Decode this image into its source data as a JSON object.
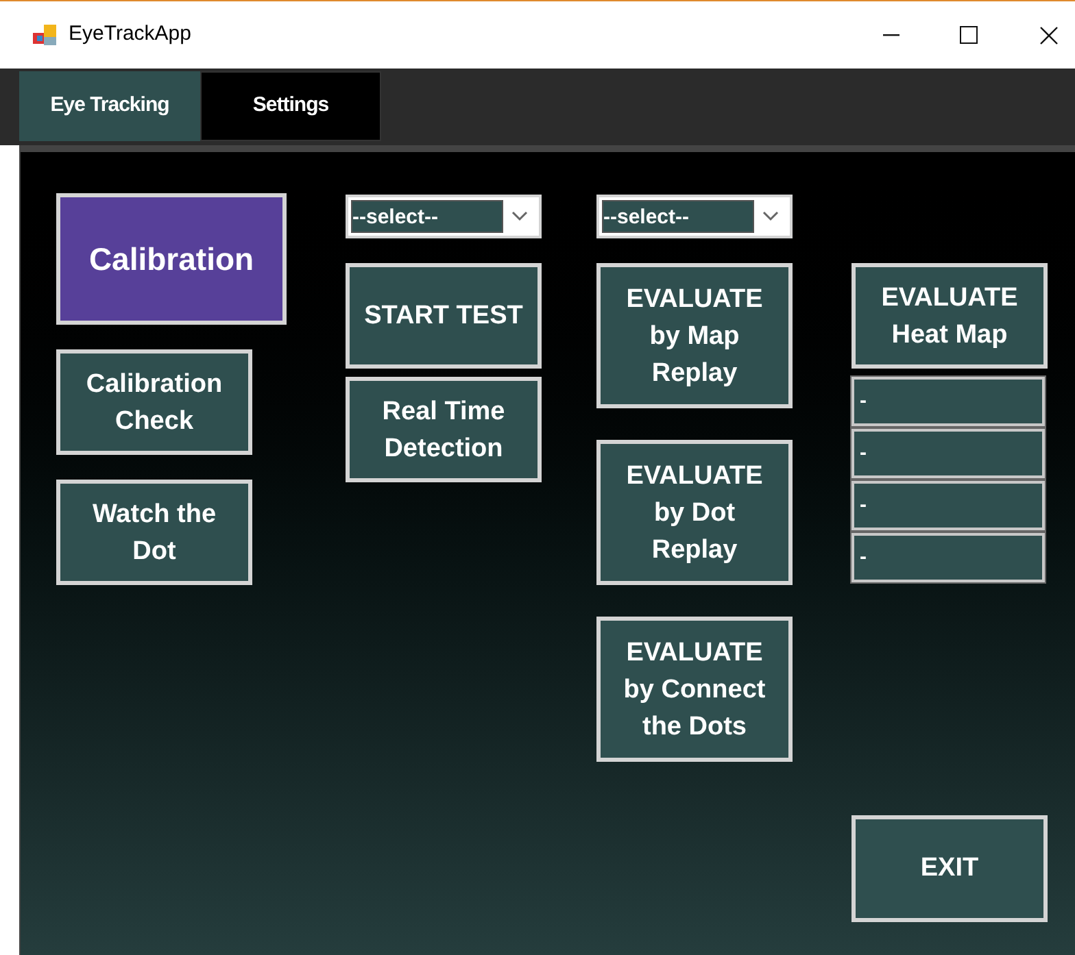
{
  "window": {
    "title": "EyeTrackApp"
  },
  "tabs": [
    {
      "label": "Eye Tracking",
      "selected": true
    },
    {
      "label": "Settings",
      "selected": false
    }
  ],
  "columns": [
    {
      "items": [
        {
          "kind": "primary",
          "label": "Calibration"
        },
        {
          "kind": "button",
          "label": "Calibration Check"
        },
        {
          "kind": "button",
          "label": "Watch the Dot"
        }
      ]
    },
    {
      "items": [
        {
          "kind": "select",
          "value": "--select--"
        },
        {
          "kind": "button",
          "label": "START TEST"
        },
        {
          "kind": "button",
          "label": "Real Time Detection"
        }
      ]
    },
    {
      "items": [
        {
          "kind": "select",
          "value": "--select--"
        },
        {
          "kind": "tall",
          "label": "EVALUATE by Map Replay"
        },
        {
          "kind": "tall",
          "label": "EVALUATE by Dot Replay"
        },
        {
          "kind": "tall",
          "label": "EVALUATE by Connect the Dots"
        }
      ]
    },
    {
      "items": [
        {
          "kind": "button",
          "label": "EVALUATE Heat Map"
        },
        {
          "kind": "result",
          "value": "-"
        },
        {
          "kind": "result",
          "value": "-"
        },
        {
          "kind": "result",
          "value": "-"
        },
        {
          "kind": "result",
          "value": "-"
        }
      ]
    }
  ],
  "exit": {
    "label": "EXIT"
  }
}
